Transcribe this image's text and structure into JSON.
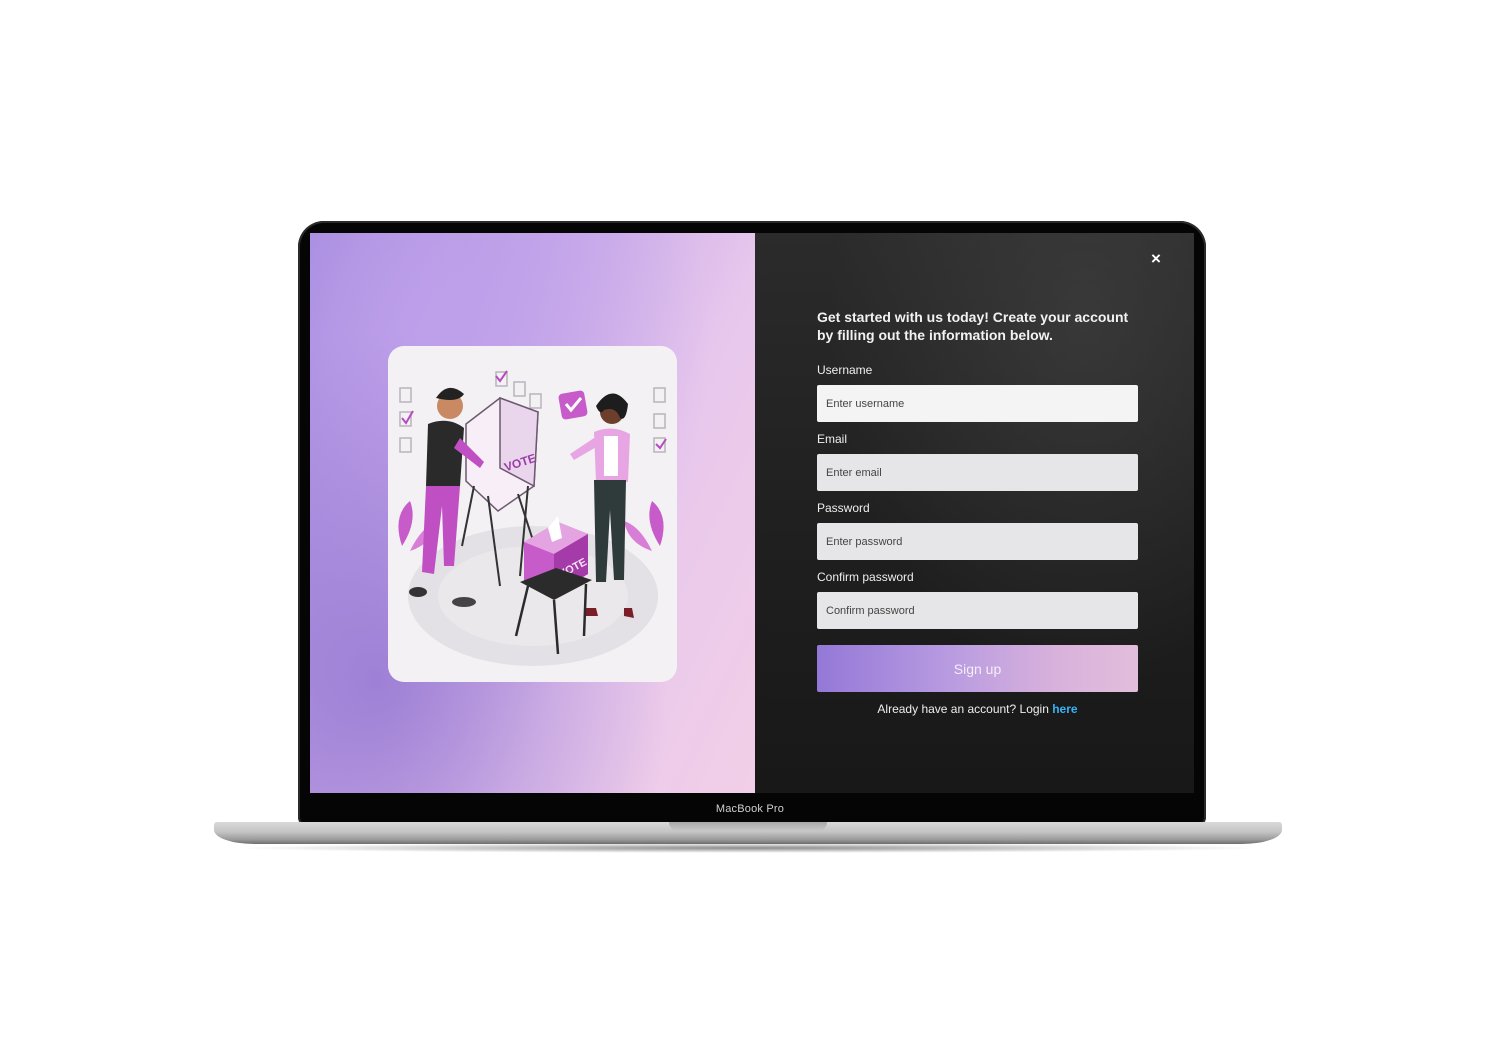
{
  "device": {
    "brand_label": "MacBook Pro"
  },
  "signup": {
    "close_icon": "×",
    "intro": "Get started with us today! Create your account by filling out the information below.",
    "fields": [
      {
        "label": "Username",
        "placeholder": "Enter username"
      },
      {
        "label": "Email",
        "placeholder": "Enter email"
      },
      {
        "label": "Password",
        "placeholder": "Enter password"
      },
      {
        "label": "Confirm password",
        "placeholder": "Confirm password"
      }
    ],
    "submit_label": "Sign up",
    "login_prompt": "Already have an account? Login ",
    "login_link": "here"
  },
  "illustration": {
    "booth_text": "VOTE",
    "box_text": "VOTE",
    "icon": "voting-illustration"
  },
  "colors": {
    "accent_link": "#33b4f4",
    "button_gradient_start": "#9478d8",
    "button_gradient_end": "#e2bddb",
    "panel_dark": "#1f1f1f"
  }
}
